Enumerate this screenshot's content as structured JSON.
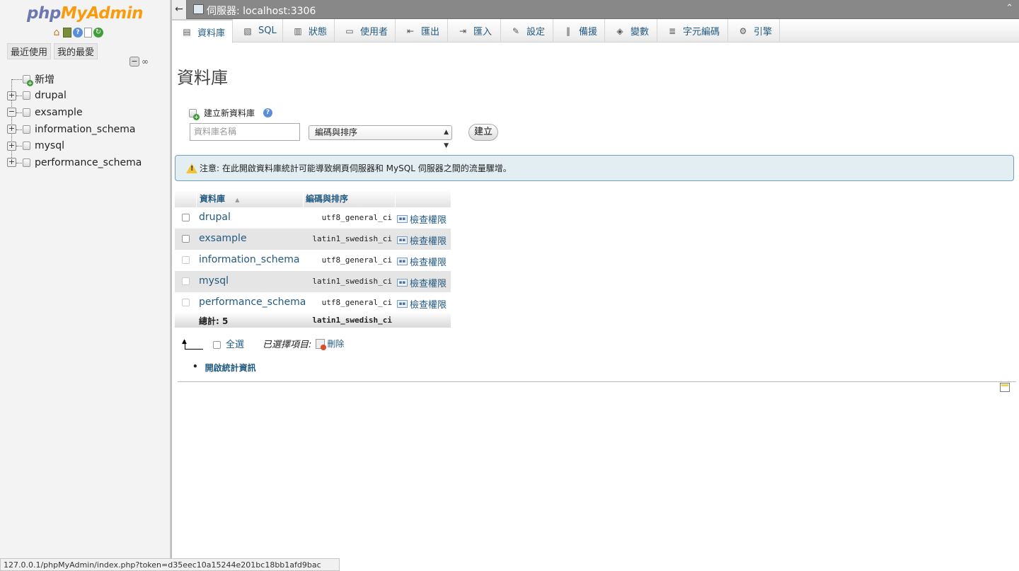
{
  "nav": {
    "logo_php": "php",
    "logo_myadmin": "MyAdmin",
    "tabs": [
      "最近使用",
      "我的最愛"
    ],
    "tree": [
      {
        "label": "新增",
        "type": "new"
      },
      {
        "label": "drupal",
        "expander": "+"
      },
      {
        "label": "exsample",
        "expander": "−"
      },
      {
        "label": "information_schema",
        "expander": "+"
      },
      {
        "label": "mysql",
        "expander": "+"
      },
      {
        "label": "performance_schema",
        "expander": "+"
      }
    ]
  },
  "topbar": {
    "back_icon": "←",
    "server": "伺服器: localhost:3306",
    "collapse_icon": "⌃"
  },
  "tabs": [
    {
      "label": "資料庫",
      "icon": "database-icon"
    },
    {
      "label": "SQL",
      "icon": "sql-icon"
    },
    {
      "label": "狀態",
      "icon": "status-icon"
    },
    {
      "label": "使用者",
      "icon": "users-icon"
    },
    {
      "label": "匯出",
      "icon": "export-icon"
    },
    {
      "label": "匯入",
      "icon": "import-icon"
    },
    {
      "label": "設定",
      "icon": "wrench-icon"
    },
    {
      "label": "備援",
      "icon": "replication-icon"
    },
    {
      "label": "變數",
      "icon": "variables-icon"
    },
    {
      "label": "字元編碼",
      "icon": "charset-icon"
    },
    {
      "label": "引擎",
      "icon": "engine-icon"
    }
  ],
  "main": {
    "title": "資料庫",
    "create_heading": "建立新資料庫",
    "db_name_placeholder": "資料庫名稱",
    "collation_selected": "編碼與排序",
    "create_button": "建立",
    "notice": "注意: 在此開啟資料庫統計可能導致網頁伺服器和 MySQL 伺服器之間的流量驟增。"
  },
  "table": {
    "headers": {
      "database": "資料庫",
      "sort_icon": "▲",
      "collation": "編碼與排序"
    },
    "rows": [
      {
        "name": "drupal",
        "collation": "utf8_general_ci",
        "action": "檢查權限"
      },
      {
        "name": "exsample",
        "collation": "latin1_swedish_ci",
        "action": "檢查權限"
      },
      {
        "name": "information_schema",
        "collation": "utf8_general_ci",
        "action": "檢查權限"
      },
      {
        "name": "mysql",
        "collation": "latin1_swedish_ci",
        "action": "檢查權限"
      },
      {
        "name": "performance_schema",
        "collation": "utf8_general_ci",
        "action": "檢查權限"
      }
    ],
    "total_label": "總計: 5",
    "total_collation": "latin1_swedish_ci"
  },
  "with_selected": {
    "check_all": "全選",
    "label": "已選擇項目:",
    "drop": "刪除"
  },
  "stats_link": "開啟統計資訊",
  "statusbar": "127.0.0.1/phpMyAdmin/index.php?token=d35eec10a15244e201bc18bb1afd9bac"
}
